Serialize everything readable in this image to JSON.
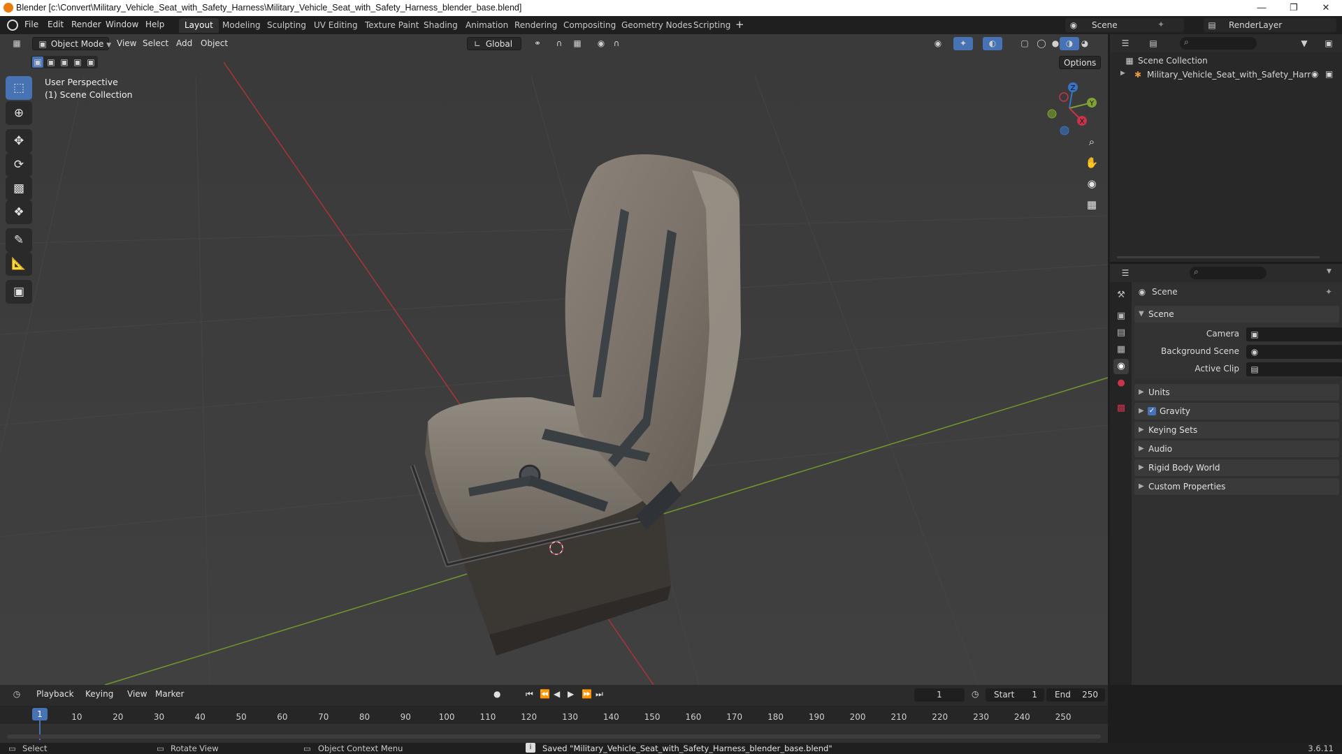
{
  "window": {
    "title": "Blender [c:\\Convert\\Military_Vehicle_Seat_with_Safety_Harness\\Military_Vehicle_Seat_with_Safety_Harness_blender_base.blend]"
  },
  "menu": {
    "items": [
      "File",
      "Edit",
      "Render",
      "Window",
      "Help"
    ],
    "workspaces": [
      "Layout",
      "Modeling",
      "Sculpting",
      "UV Editing",
      "Texture Paint",
      "Shading",
      "Animation",
      "Rendering",
      "Compositing",
      "Geometry Nodes",
      "Scripting"
    ],
    "active_workspace": "Layout",
    "scene_name": "Scene",
    "view_layer": "RenderLayer"
  },
  "viewport": {
    "mode": "Object Mode",
    "menus": [
      "View",
      "Select",
      "Add",
      "Object"
    ],
    "transform_orientation": "Global",
    "options_label": "Options",
    "info_line1": "User Perspective",
    "info_line2": "(1) Scene Collection",
    "gizmo_axes": [
      "Z",
      "Y",
      "X"
    ]
  },
  "outliner": {
    "collection": "Scene Collection",
    "object": "Military_Vehicle_Seat_with_Safety_Harr"
  },
  "properties": {
    "context": "Scene",
    "section": "Scene",
    "fields": [
      "Camera",
      "Background Scene",
      "Active Clip"
    ],
    "panels": [
      "Units",
      "Gravity",
      "Keying Sets",
      "Audio",
      "Rigid Body World",
      "Custom Properties"
    ],
    "gravity_checked": true
  },
  "timeline": {
    "menus": [
      "Playback",
      "Keying",
      "View",
      "Marker"
    ],
    "current_frame": "1",
    "start_label": "Start",
    "start": "1",
    "end_label": "End",
    "end": "250",
    "ticks": [
      "1",
      "10",
      "20",
      "30",
      "40",
      "50",
      "60",
      "70",
      "80",
      "90",
      "100",
      "110",
      "120",
      "130",
      "140",
      "150",
      "160",
      "170",
      "180",
      "190",
      "200",
      "210",
      "220",
      "230",
      "240",
      "250"
    ]
  },
  "status": {
    "select": "Select",
    "rotate": "Rotate View",
    "context_menu": "Object Context Menu",
    "message": "Saved \"Military_Vehicle_Seat_with_Safety_Harness_blender_base.blend\"",
    "version": "3.6.11"
  }
}
